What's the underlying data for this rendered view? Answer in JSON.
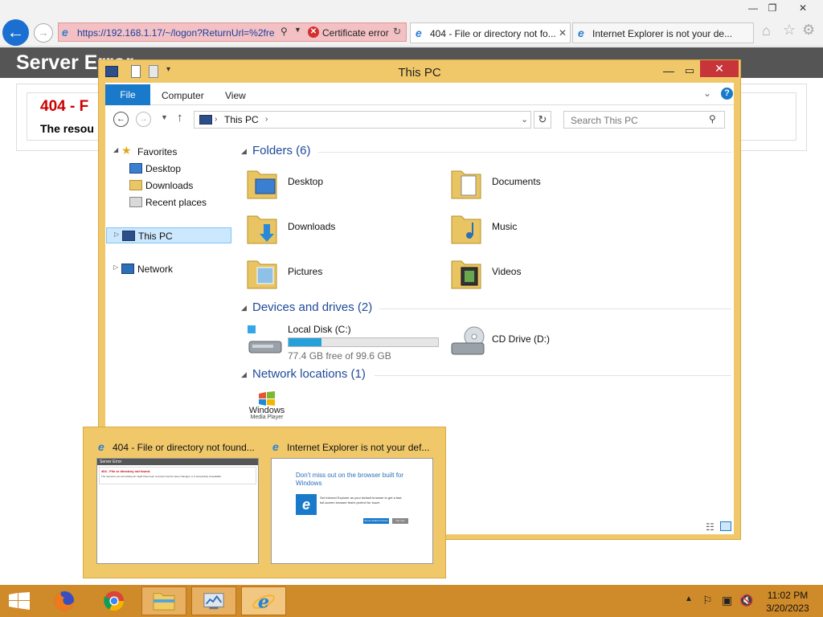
{
  "ie": {
    "caption_min": "—",
    "caption_max": "❐",
    "caption_close": "✕",
    "address_url": "https://192.168.1.17/~/logon?ReturnUrl=%2fre",
    "cert_error": "Certificate error",
    "tabs": [
      {
        "label": "404 - File or directory not fo..."
      },
      {
        "label": "Internet Explorer is not your de..."
      }
    ],
    "page": {
      "banner": "Server Error",
      "error_title": "404 - F",
      "error_desc": "The resou"
    }
  },
  "explorer": {
    "title": "This PC",
    "ribbon": {
      "file": "File",
      "computer": "Computer",
      "view": "View"
    },
    "breadcrumb": "This PC",
    "search_placeholder": "Search This PC",
    "nav": {
      "favorites": "Favorites",
      "desktop": "Desktop",
      "downloads": "Downloads",
      "recent": "Recent places",
      "thispc": "This PC",
      "network": "Network"
    },
    "groups": {
      "folders": "Folders (6)",
      "devices": "Devices and drives (2)",
      "network": "Network locations (1)"
    },
    "folders": [
      {
        "name": "Desktop"
      },
      {
        "name": "Documents"
      },
      {
        "name": "Downloads"
      },
      {
        "name": "Music"
      },
      {
        "name": "Pictures"
      },
      {
        "name": "Videos"
      }
    ],
    "drives": {
      "c_name": "Local Disk (C:)",
      "c_free": "77.4 GB free of 99.6 GB",
      "c_used_fraction": 0.223,
      "d_name": "CD Drive (D:)"
    },
    "network_item_label": "Windows",
    "network_item_sub": "Media Player"
  },
  "thumbs": [
    {
      "title": "404 - File or directory not found...",
      "banner": "Server Error",
      "line1": "404 - File or directory not found.",
      "line2": "The resource you are looking for might have been removed, had its name changed, or is temporarily unavailable."
    },
    {
      "title": "Internet Explorer is not your def...",
      "headline": "Don't miss out on the browser built for Windows",
      "body": "Set Internet Explorer as your default browser to get a fast, full-screen browser that's perfect for touch",
      "btn1": "Set as default browser",
      "btn2": "Not now"
    }
  ],
  "taskbar": {
    "time": "11:02 PM",
    "date": "3/20/2023"
  }
}
